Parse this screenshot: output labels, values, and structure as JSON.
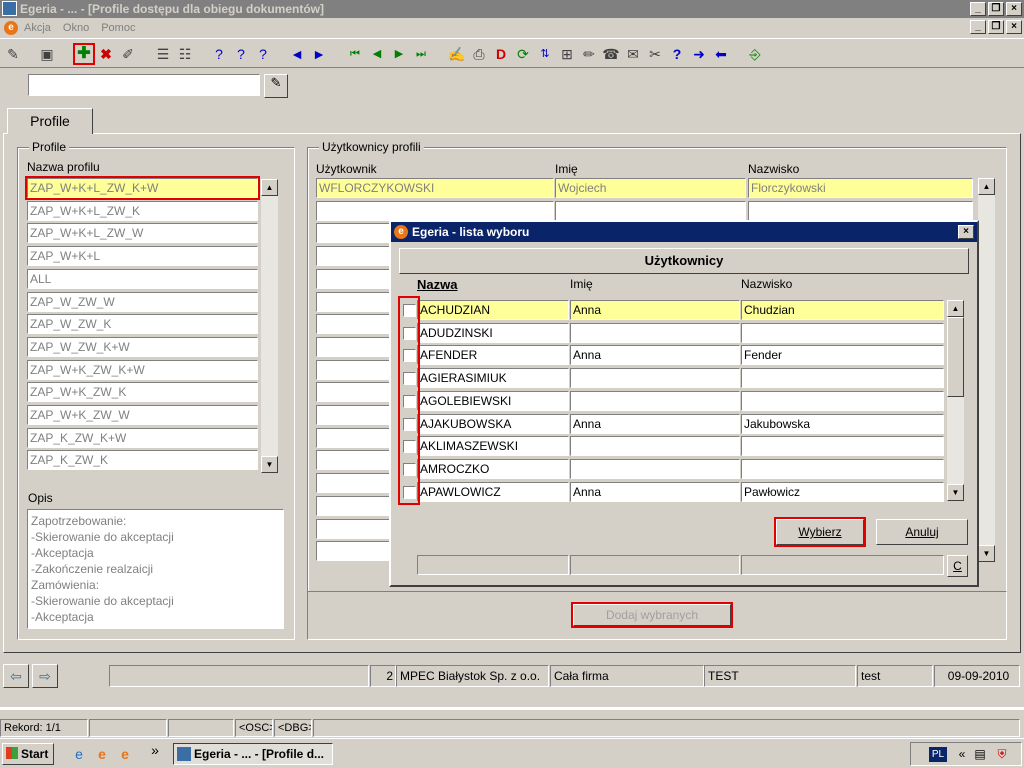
{
  "window": {
    "title": "Egeria - ... - [Profile dostępu dla obiegu dokumentów]"
  },
  "menu": {
    "items": [
      "Akcja",
      "Okno",
      "Pomoc"
    ]
  },
  "tabs": [
    {
      "label": "Profile"
    }
  ],
  "profiles_group": {
    "title": "Profile",
    "column_label": "Nazwa profilu",
    "items": [
      "ZAP_W+K+L_ZW_K+W",
      "ZAP_W+K+L_ZW_K",
      "ZAP_W+K+L_ZW_W",
      "ZAP_W+K+L",
      "ALL",
      "ZAP_W_ZW_W",
      "ZAP_W_ZW_K",
      "ZAP_W_ZW_K+W",
      "ZAP_W+K_ZW_K+W",
      "ZAP_W+K_ZW_K",
      "ZAP_W+K_ZW_W",
      "ZAP_K_ZW_K+W",
      "ZAP_K_ZW_K"
    ],
    "opis_label": "Opis",
    "opis_lines": [
      "Zapotrzebowanie:",
      "-Skierowanie do akceptacji",
      "-Akceptacja",
      "-Zakończenie realzaicji",
      "Zamówienia:",
      "-Skierowanie do akceptacji",
      "-Akceptacja"
    ]
  },
  "users_group": {
    "title": "Użytkownicy profili",
    "columns": [
      "Użytkownik",
      "Imię",
      "Nazwisko"
    ],
    "first_row": [
      "WFLORCZYKOWSKI",
      "Wojciech",
      "Florczykowski"
    ],
    "add_button": "Dodaj wybranych"
  },
  "dialog": {
    "title": "Egeria - lista wyboru",
    "header": "Użytkownicy",
    "columns": [
      "Nazwa",
      "Imię",
      "Nazwisko"
    ],
    "rows": [
      [
        "ACHUDZIAN",
        "Anna",
        "Chudzian"
      ],
      [
        "ADUDZINSKI",
        "",
        ""
      ],
      [
        "AFENDER",
        "Anna",
        "Fender"
      ],
      [
        "AGIERASIMIUK",
        "",
        ""
      ],
      [
        "AGOLEBIEWSKI",
        "",
        ""
      ],
      [
        "AJAKUBOWSKA",
        "Anna",
        "Jakubowska"
      ],
      [
        "AKLIMASZEWSKI",
        "",
        ""
      ],
      [
        "AMROCZKO",
        "",
        ""
      ],
      [
        "APAWLOWICZ",
        "Anna",
        "Pawłowicz"
      ]
    ],
    "select_button": "Wybierz",
    "cancel_button": "Anuluj",
    "c_button": "C"
  },
  "statusbar": {
    "num": "2",
    "company": "MPEC Białystok Sp. z o.o.",
    "scope": "Cała firma",
    "db": "TEST",
    "user": "test",
    "date": "09-09-2010"
  },
  "recordbar": {
    "record": "Rekord: 1/1",
    "osc": "<OSC>",
    "dbg": "<DBG>"
  },
  "taskbar": {
    "start": "Start",
    "task": "Egeria - ... - [Profile d...",
    "lang": "PL"
  }
}
